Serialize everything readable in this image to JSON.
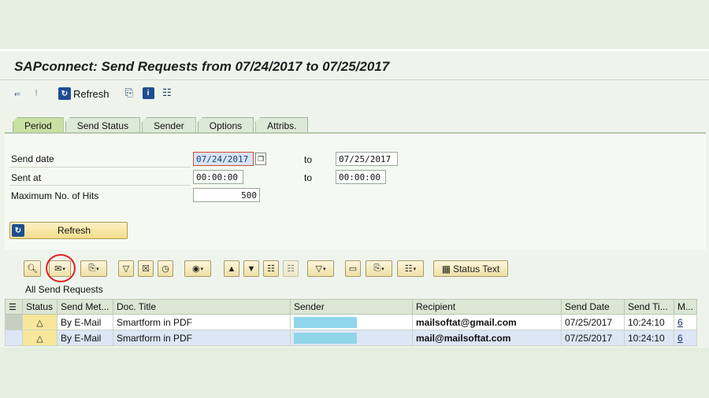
{
  "window": {
    "title": "SAPconnect: Send Requests from 07/24/2017 to 07/25/2017"
  },
  "toolbar": {
    "refresh_label": "Refresh",
    "icons": [
      "collapse-all-icon",
      "expand-all-icon",
      "refresh-icon",
      "copy-icon",
      "info-icon",
      "hierarchy-icon"
    ]
  },
  "tabs": [
    {
      "label": "Period",
      "active": true
    },
    {
      "label": "Send Status"
    },
    {
      "label": "Sender"
    },
    {
      "label": "Options"
    },
    {
      "label": "Attribs."
    }
  ],
  "form": {
    "send_date_label": "Send date",
    "send_date_from": "07/24/2017",
    "send_date_to": "07/25/2017",
    "sent_at_label": "Sent at",
    "sent_at_from": "00:00:00",
    "sent_at_to": "00:00:00",
    "max_hits_label": "Maximum No. of Hits",
    "max_hits": "500",
    "to_label": "to",
    "refresh_button": "Refresh"
  },
  "alv_toolbar": {
    "status_text_label": "Status Text"
  },
  "grid": {
    "title": "All Send Requests",
    "columns": [
      "Status",
      "Send Met...",
      "Doc. Title",
      "Sender",
      "Recipient",
      "Send Date",
      "Send Ti...",
      "M..."
    ],
    "rows": [
      {
        "status": "△",
        "method": "By E-Mail",
        "doc_title": "Smartform in PDF",
        "sender": "",
        "recipient": "mailsoftat@gmail.com",
        "send_date": "07/25/2017",
        "send_time": "10:24:10",
        "m": "6"
      },
      {
        "status": "△",
        "method": "By E-Mail",
        "doc_title": "Smartform in PDF",
        "sender": "",
        "recipient": "mail@mailsoftat.com",
        "send_date": "07/25/2017",
        "send_time": "10:24:10",
        "m": "6"
      }
    ]
  },
  "colors": {
    "background": "#e4eee1",
    "button_yellow": "#f3dc8a",
    "selected_field": "#d8e4f5",
    "highlight_circle": "#e02020"
  }
}
